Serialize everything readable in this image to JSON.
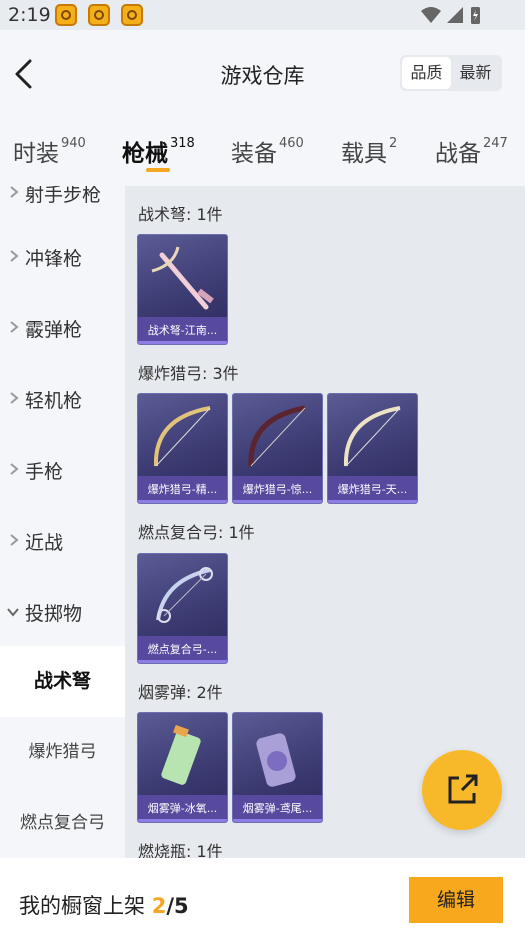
{
  "status": {
    "time": "2:19"
  },
  "header": {
    "title": "游戏仓库",
    "sort_options": [
      "品质",
      "最新"
    ],
    "sort_active": "品质"
  },
  "tabs": [
    {
      "label": "时装",
      "count": "940"
    },
    {
      "label": "枪械",
      "count": "318"
    },
    {
      "label": "装备",
      "count": "460"
    },
    {
      "label": "载具",
      "count": "2"
    },
    {
      "label": "战备",
      "count": "247"
    }
  ],
  "sidebar": {
    "partial": "射手步枪",
    "categories": [
      "冲锋枪",
      "霰弹枪",
      "轻机枪",
      "手枪",
      "近战",
      "投掷物"
    ],
    "subcategories": [
      "战术弩",
      "爆炸猎弓",
      "燃点复合弓"
    ]
  },
  "groups": [
    {
      "title": "战术弩: 1件",
      "items": [
        "战术弩-江南..."
      ]
    },
    {
      "title": "爆炸猎弓: 3件",
      "items": [
        "爆炸猎弓-精...",
        "爆炸猎弓-惊...",
        "爆炸猎弓-天..."
      ]
    },
    {
      "title": "燃点复合弓: 1件",
      "items": [
        "燃点复合弓-..."
      ]
    },
    {
      "title": "烟雾弹: 2件",
      "items": [
        "烟雾弹-冰氧...",
        "烟雾弹-鸢尾..."
      ]
    },
    {
      "title": "燃烧瓶: 1件",
      "items": []
    }
  ],
  "footer": {
    "shelf_label": "我的橱窗上架",
    "shelf_current": "2",
    "shelf_total": "/5",
    "edit_label": "编辑"
  },
  "colors": {
    "accent": "#f5a623",
    "card_bg": "#3c3b72",
    "card_label": "#56499e"
  }
}
